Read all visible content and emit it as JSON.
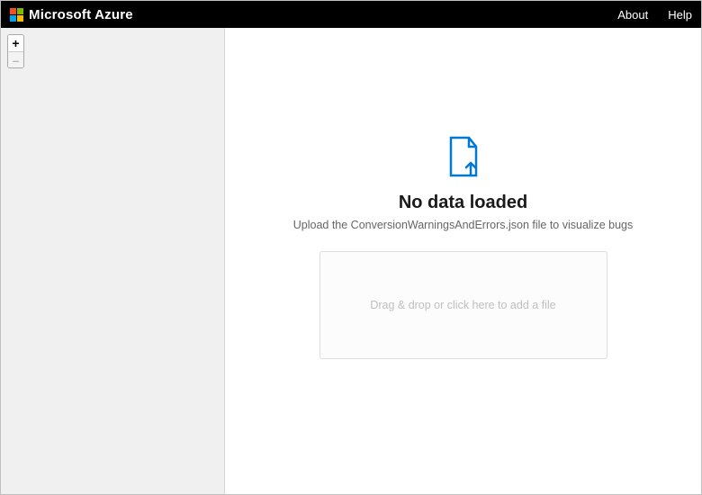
{
  "topbar": {
    "brand": "Microsoft Azure",
    "links": {
      "about": "About",
      "help": "Help"
    }
  },
  "zoom": {
    "in_label": "+",
    "out_label": "–"
  },
  "empty_state": {
    "title": "No data loaded",
    "subtitle": "Upload the ConversionWarningsAndErrors.json file to visualize bugs",
    "dropzone_text": "Drag & drop or click here to add a file"
  },
  "colors": {
    "accent": "#0078d4"
  }
}
